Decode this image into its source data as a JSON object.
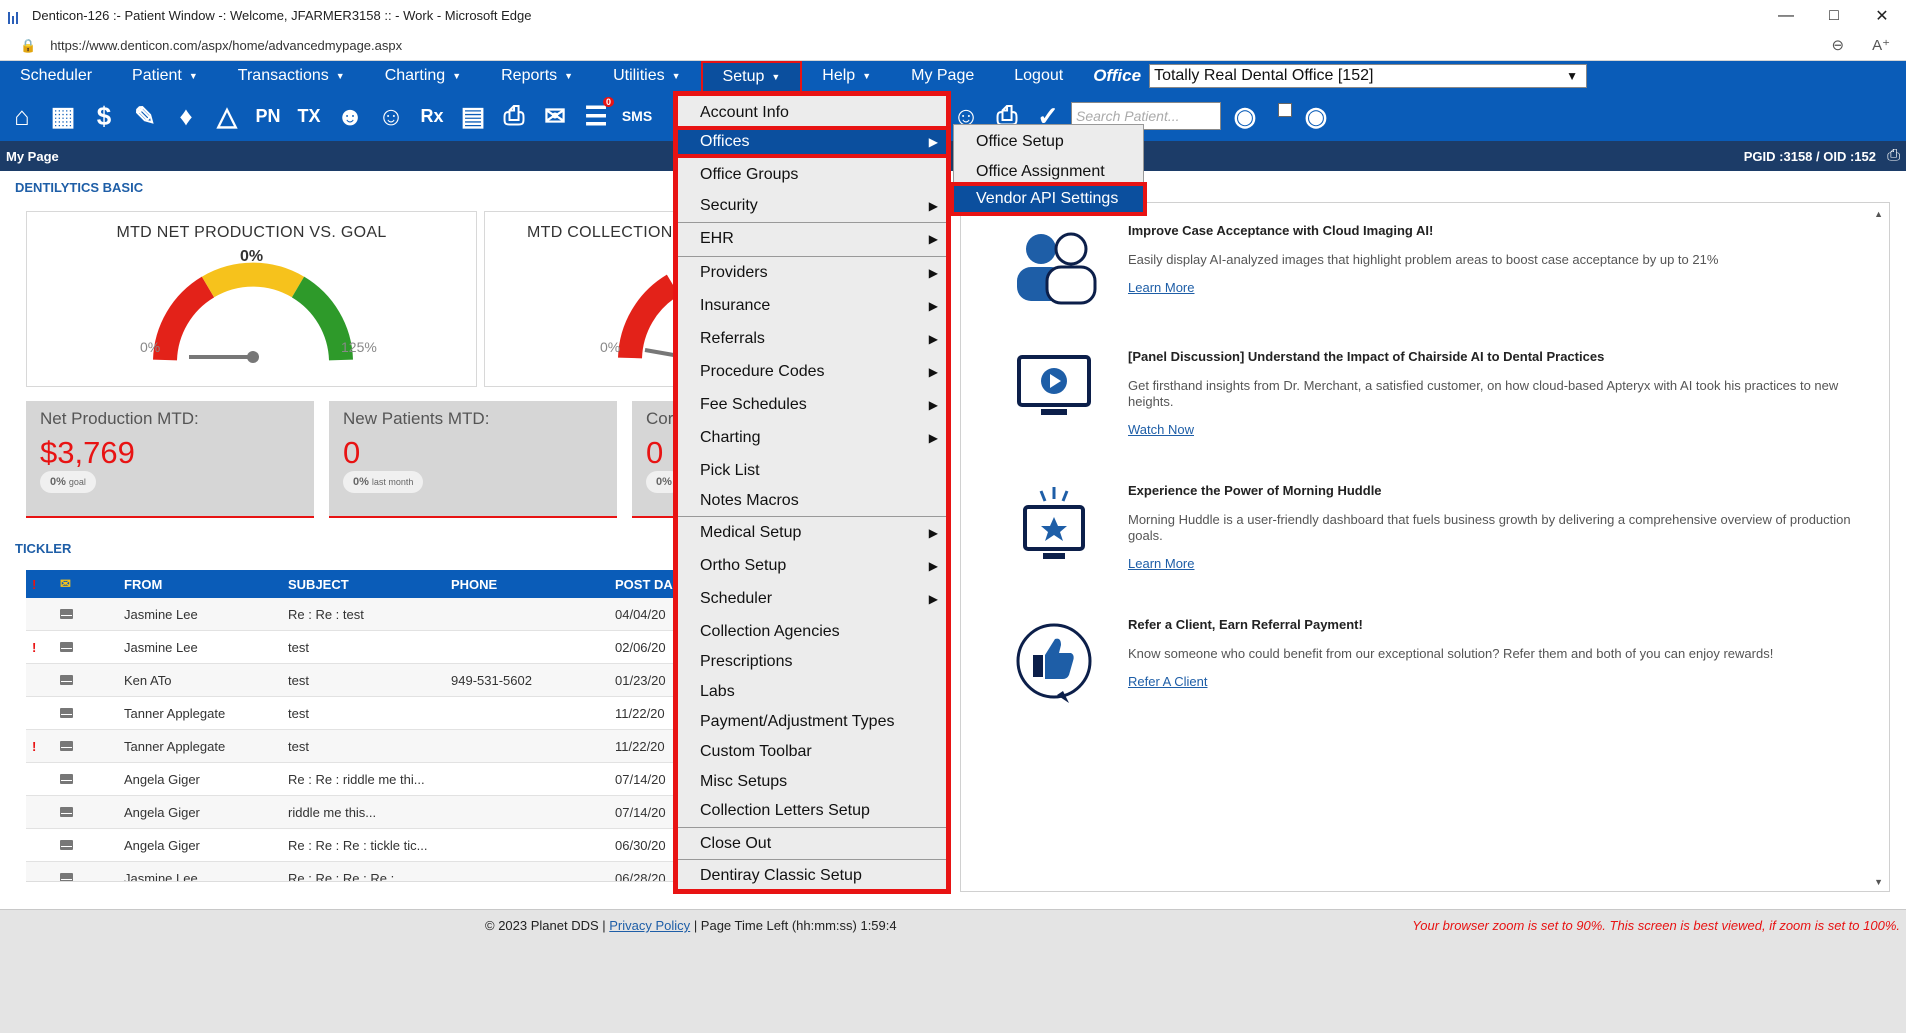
{
  "window": {
    "title": "Denticon-126 :- Patient Window -: Welcome, JFARMER3158 :: - Work - Microsoft Edge",
    "url": "https://www.denticon.com/aspx/home/advancedmypage.aspx"
  },
  "nav": {
    "items": [
      "Scheduler",
      "Patient",
      "Transactions",
      "Charting",
      "Reports",
      "Utilities",
      "Setup",
      "Help",
      "My Page",
      "Logout"
    ],
    "office_label": "Office",
    "office_value": "Totally Real Dental Office [152]"
  },
  "toolbar": {
    "icons": [
      "home-icon",
      "calendar-icon",
      "dollar-icon",
      "edit-icon",
      "tooth-icon",
      "teeth-icon",
      "pn-icon",
      "tx-icon",
      "add-user-icon",
      "add-group-icon",
      "rx-icon",
      "document-icon",
      "printer-icon",
      "email-icon",
      "message-icon",
      "sms-icon"
    ],
    "pn_label": "PN",
    "tx_label": "TX",
    "rx_label": "Rx",
    "sms_label": "SMS",
    "message_badge": "0",
    "search_placeholder": "Search Patient..."
  },
  "page": {
    "title": "My Page",
    "ids": "PGID :3158  /  OID :152"
  },
  "dentilytics": {
    "section_title": "DENTILYTICS BASIC",
    "gauge1": {
      "title": "MTD NET PRODUCTION VS. GOAL",
      "pct": "0%",
      "min": "0%",
      "max": "125%",
      "value_fraction": 0
    },
    "gauge2": {
      "title": "MTD COLLECTION",
      "min": "0%"
    },
    "cards": [
      {
        "label": "Net Production MTD:",
        "value": "$3,769",
        "pill": "0%",
        "pill_small": "goal"
      },
      {
        "label": "New Patients MTD:",
        "value": "0",
        "pill": "0%",
        "pill_small": "last month"
      },
      {
        "label": "Cor",
        "value": "0",
        "pill": "0%",
        "pill_small": ""
      }
    ]
  },
  "tickler": {
    "section_title": "TICKLER",
    "headers": {
      "flag": "!",
      "from": "FROM",
      "subject": "SUBJECT",
      "phone": "PHONE",
      "post": "POST DA"
    },
    "rows": [
      {
        "flag": "",
        "from": "Jasmine Lee",
        "subject": "Re : Re : test",
        "phone": "",
        "post": "04/04/20"
      },
      {
        "flag": "!",
        "from": "Jasmine Lee",
        "subject": "test",
        "phone": "",
        "post": "02/06/20"
      },
      {
        "flag": "",
        "from": "Ken ATo",
        "subject": "test",
        "phone": "949-531-5602",
        "post": "01/23/20"
      },
      {
        "flag": "",
        "from": "Tanner Applegate",
        "subject": "test",
        "phone": "",
        "post": "11/22/20"
      },
      {
        "flag": "!",
        "from": "Tanner Applegate",
        "subject": "test",
        "phone": "",
        "post": "11/22/20"
      },
      {
        "flag": "",
        "from": "Angela Giger",
        "subject": "Re : Re : riddle me thi...",
        "phone": "",
        "post": "07/14/20"
      },
      {
        "flag": "",
        "from": "Angela Giger",
        "subject": "riddle me this...",
        "phone": "",
        "post": "07/14/20"
      },
      {
        "flag": "",
        "from": "Angela Giger",
        "subject": "Re : Re : Re : tickle tic...",
        "phone": "",
        "post": "06/30/20"
      },
      {
        "flag": "",
        "from": "Jasmine Lee",
        "subject": "Re : Re : Re : Re :",
        "phone": "",
        "post": "06/28/20"
      }
    ]
  },
  "promos": [
    {
      "title": "Improve Case Acceptance with Cloud Imaging AI!",
      "desc": "Easily display AI-analyzed images that highlight problem areas to boost case acceptance by up to 21%",
      "link": "Learn More"
    },
    {
      "title": "[Panel Discussion] Understand the Impact of Chairside AI to Dental Practices",
      "desc": "Get firsthand insights from Dr. Merchant, a satisfied customer, on how cloud-based Apteryx with AI took his practices to new heights.",
      "link": "Watch Now"
    },
    {
      "title": "Experience the Power of Morning Huddle",
      "desc": "Morning Huddle is a user-friendly dashboard that fuels business growth by delivering a comprehensive overview of production goals.",
      "link": "Learn More"
    },
    {
      "title": "Refer a Client, Earn Referral Payment!",
      "desc": "Know someone who could benefit from our exceptional solution? Refer them and both of you can enjoy rewards!",
      "link": "Refer A Client"
    }
  ],
  "setup_menu": {
    "items": [
      {
        "label": "Account Info",
        "arrow": false
      },
      {
        "label": "Offices",
        "arrow": true
      },
      {
        "label": "Office Groups",
        "arrow": false
      },
      {
        "label": "Security",
        "arrow": true
      },
      {
        "label": "EHR",
        "arrow": true
      },
      {
        "label": "Providers",
        "arrow": true
      },
      {
        "label": "Insurance",
        "arrow": true
      },
      {
        "label": "Referrals",
        "arrow": true
      },
      {
        "label": "Procedure Codes",
        "arrow": true
      },
      {
        "label": "Fee Schedules",
        "arrow": true
      },
      {
        "label": "Charting",
        "arrow": true
      },
      {
        "label": "Pick List",
        "arrow": false
      },
      {
        "label": "Notes Macros",
        "arrow": false
      },
      {
        "label": "Medical Setup",
        "arrow": true
      },
      {
        "label": "Ortho Setup",
        "arrow": true
      },
      {
        "label": "Scheduler",
        "arrow": true
      },
      {
        "label": "Collection Agencies",
        "arrow": false
      },
      {
        "label": "Prescriptions",
        "arrow": false
      },
      {
        "label": "Labs",
        "arrow": false
      },
      {
        "label": "Payment/Adjustment Types",
        "arrow": false
      },
      {
        "label": "Custom Toolbar",
        "arrow": false
      },
      {
        "label": "Misc Setups",
        "arrow": false
      },
      {
        "label": "Collection Letters Setup",
        "arrow": false
      },
      {
        "label": "Close Out",
        "arrow": false
      },
      {
        "label": "Dentiray Classic Setup",
        "arrow": false
      }
    ],
    "highlighted": "Offices"
  },
  "offices_submenu": {
    "items": [
      "Office Setup",
      "Office Assignment",
      "Vendor API Settings"
    ],
    "highlighted": "Vendor API Settings"
  },
  "footer": {
    "copyright": "© 2023 Planet DDS |",
    "privacy": "Privacy Policy",
    "time_left": "| Page Time Left (hh:mm:ss) 1:59:4",
    "zoom_warning": "Your browser zoom is set to 90%. This screen is best viewed, if zoom is set to 100%."
  },
  "colors": {
    "nav_blue": "#0a5cb8",
    "dark_strip": "#1c3c68",
    "highlight_red": "#e81313",
    "gauge_red": "#e32219",
    "gauge_yellow": "#f6c21c",
    "gauge_green": "#2e9a2a"
  }
}
